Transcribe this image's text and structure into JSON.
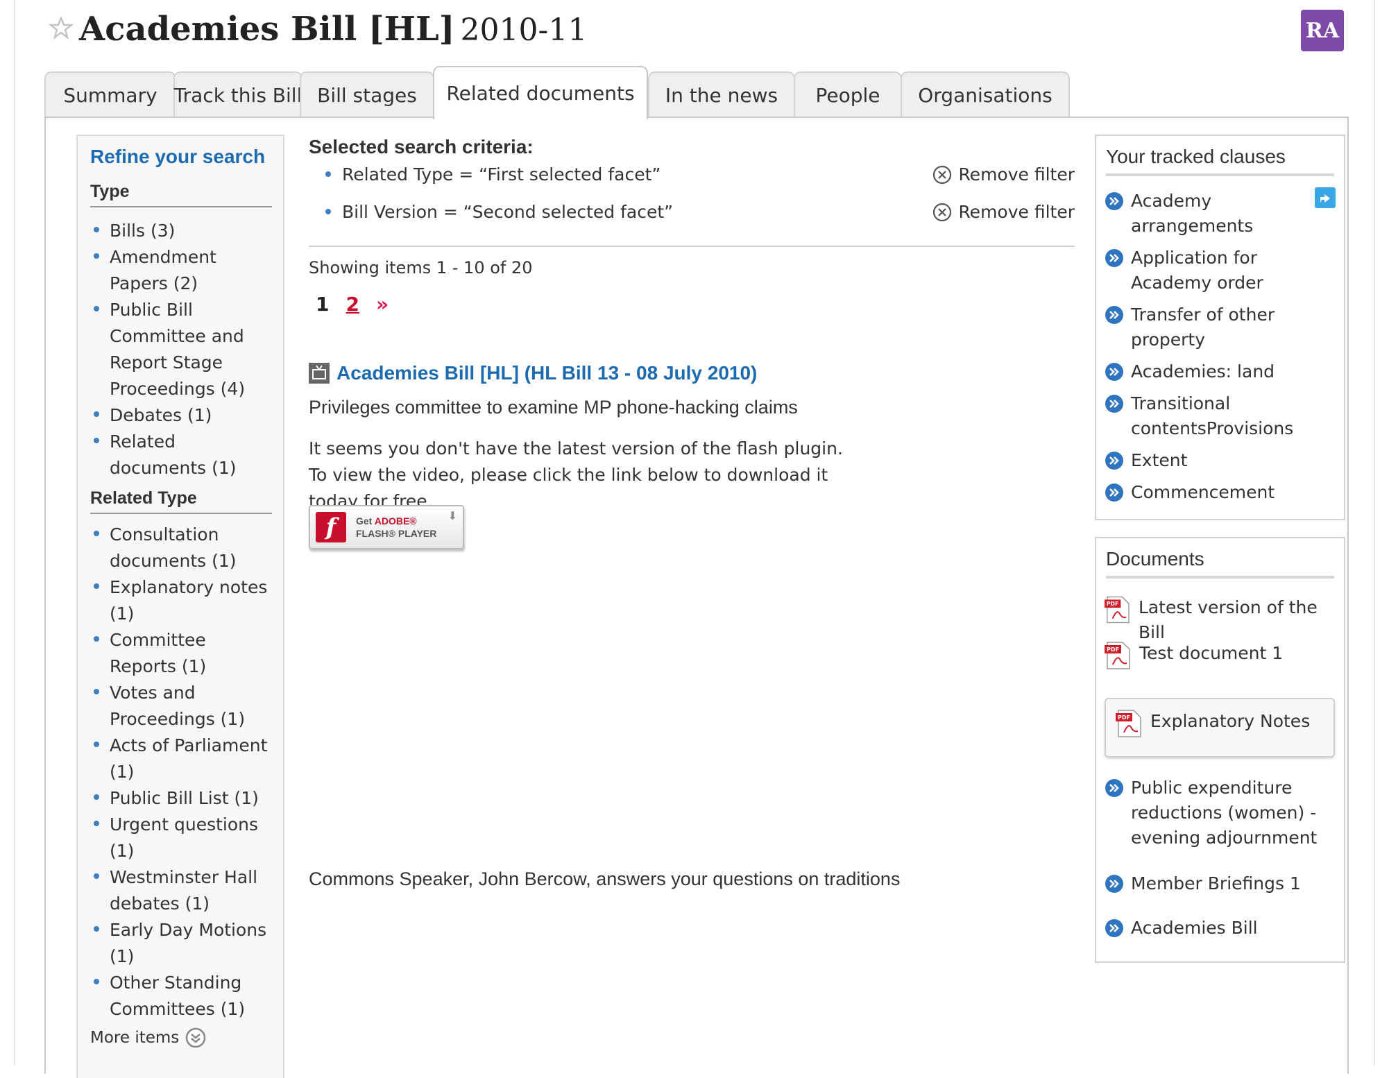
{
  "header": {
    "title": "Academies Bill [HL]",
    "year": "2010-11",
    "avatar_initials": "RA",
    "avatar_color": "#7e4aa8"
  },
  "tabs": [
    {
      "label": "Summary",
      "active": false
    },
    {
      "label": "Track this Bill",
      "active": false
    },
    {
      "label": "Bill stages",
      "active": false
    },
    {
      "label": "Related documents",
      "active": true
    },
    {
      "label": "In the news",
      "active": false
    },
    {
      "label": "People",
      "active": false
    },
    {
      "label": "Organisations",
      "active": false
    }
  ],
  "refine": {
    "title": "Refine your search",
    "type_heading": "Type",
    "type_items": [
      "Bills (3)",
      "Amendment Papers (2)",
      "Public Bill Committee and Report Stage Proceedings (4)",
      "Debates (1)",
      "Related documents (1)"
    ],
    "related_heading": "Related Type",
    "related_items": [
      "Consultation documents (1)",
      "Explanatory notes (1)",
      "Committee Reports (1)",
      "Votes and Proceedings (1)",
      "Acts of Parliament (1)",
      "Public Bill List (1)",
      "Urgent questions (1)",
      "Westminster Hall debates (1)",
      "Early Day Motions (1)",
      "Other Standing Committees (1)"
    ],
    "more_label": "More items"
  },
  "criteria": {
    "title": "Selected search criteria:",
    "filters": [
      {
        "text": "Related Type = “First selected facet”",
        "remove_label": "Remove filter"
      },
      {
        "text": "Bill Version = “Second selected facet”",
        "remove_label": "Remove filter"
      }
    ]
  },
  "results": {
    "showing": "Showing items 1 - 10 of 20",
    "pages": [
      "1",
      "2"
    ],
    "current_page": "1",
    "next_symbol": "»",
    "item_title": "Academies Bill [HL] (HL Bill 13 - 08 July 2010)",
    "item_desc": "Privileges committee to examine MP phone-hacking claims",
    "flash_message": "It seems you don't have the latest version of the flash plugin. To view the video, please click the link below to download it today for free.",
    "flash_badge": {
      "line1_prefix": "Get ",
      "line1_brand": "ADOBE®",
      "line2": "FLASH® PLAYER",
      "logo_letter": "f"
    },
    "second_desc": "Commons Speaker, John Bercow, answers your questions on traditions"
  },
  "tracked_clauses": {
    "title": "Your tracked clauses",
    "items": [
      "Academy arrangements",
      "Application for Academy order",
      "Transfer of other property",
      "Academies: land",
      "Transitional contentsProvisions",
      "Extent",
      "Commencement"
    ]
  },
  "documents": {
    "title": "Documents",
    "pdf_items": [
      "Latest version of the Bill",
      "Test document 1"
    ],
    "highlighted_item": "Explanatory Notes",
    "link_items": [
      "Public expenditure reductions (women) - evening adjournment",
      "Member Briefings 1",
      "Academies Bill"
    ]
  },
  "colors": {
    "link_blue": "#1c6bb0",
    "pager_red": "#c8102e",
    "bullet_blue": "#3d7ec3"
  }
}
